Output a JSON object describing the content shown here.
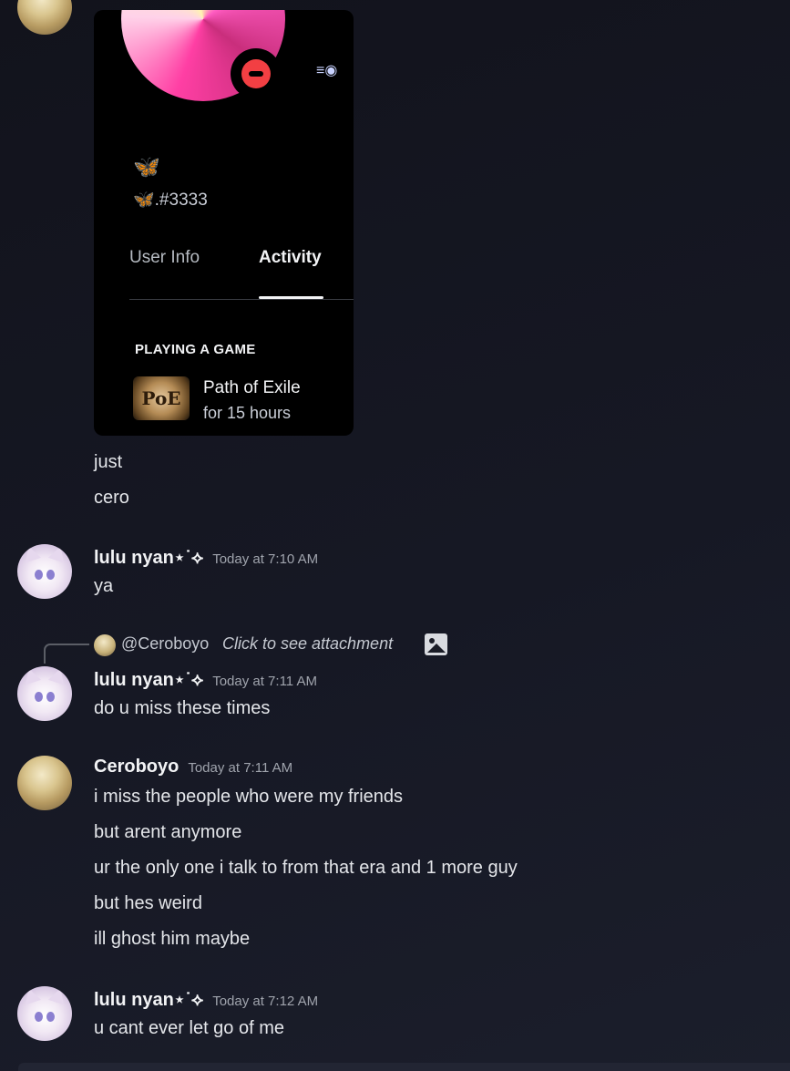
{
  "card": {
    "emoji": "🦋",
    "tag": "🦋.#3333",
    "tabs": {
      "user_info": "User Info",
      "activity": "Activity"
    },
    "activity_header": "PLAYING A GAME",
    "game": {
      "icon_text": "PoE",
      "name": "Path of Exile",
      "duration": "for 15 hours"
    },
    "nitro_icon": "nitro-badge-icon"
  },
  "messages": {
    "cont1": "just",
    "cont2": "cero",
    "m1": {
      "user": "lulu nyan⋆˙⟡",
      "time": "Today at 7:10 AM",
      "lines": [
        "ya"
      ]
    },
    "m2": {
      "reply": {
        "user": "@Ceroboyo",
        "text": "Click to see attachment",
        "icon": "image-icon"
      },
      "user": "lulu nyan⋆˙⟡",
      "time": "Today at 7:11 AM",
      "lines": [
        "do u miss these times"
      ]
    },
    "m3": {
      "user": "Ceroboyo",
      "time": "Today at 7:11 AM",
      "lines": [
        "i miss the people who were my friends",
        "but arent anymore",
        "ur the only one i talk to from that era and 1 more guy",
        "but hes weird",
        "ill ghost him maybe"
      ]
    },
    "m4": {
      "user": "lulu nyan⋆˙⟡",
      "time": "Today at 7:12 AM",
      "lines": [
        "u cant ever let go of me"
      ]
    }
  },
  "colors": {
    "dnd": "#f23f43",
    "background": "#161824",
    "username": "#f2f3f5",
    "timestamp": "#a0a4ad"
  }
}
